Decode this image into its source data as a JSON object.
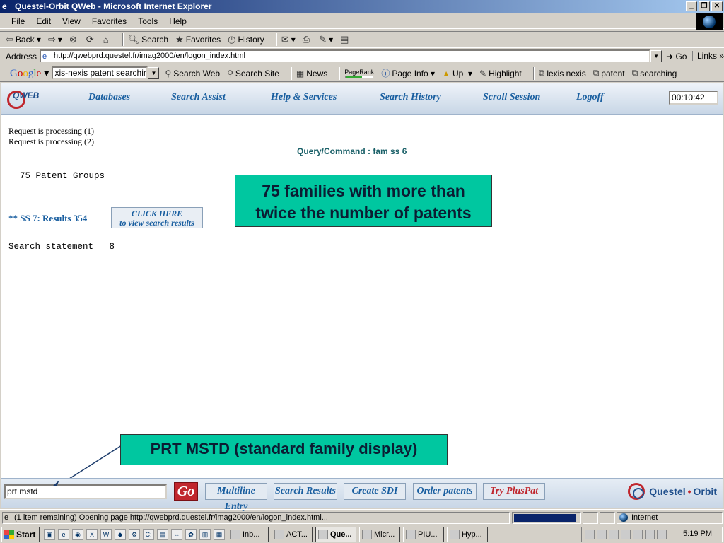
{
  "window": {
    "title": "Questel-Orbit QWeb - Microsoft Internet Explorer"
  },
  "menu": [
    "File",
    "Edit",
    "View",
    "Favorites",
    "Tools",
    "Help"
  ],
  "toolbar": {
    "back": "Back",
    "search": "Search",
    "favorites": "Favorites",
    "history": "History"
  },
  "address": {
    "label": "Address",
    "url": "http://qwebprd.questel.fr/imag2000/en/logon_index.html",
    "go": "Go",
    "links": "Links"
  },
  "google": {
    "query": "xis-nexis patent searching",
    "search_web": "Search Web",
    "search_site": "Search Site",
    "news": "News",
    "pagerank": "PageRank",
    "page_info": "Page Info",
    "up": "Up",
    "highlight": "Highlight",
    "terms": [
      "lexis nexis",
      "patent",
      "searching"
    ]
  },
  "qweb": {
    "nav": [
      "Databases",
      "Search Assist",
      "Help & Services",
      "Search History",
      "Scroll Session",
      "Logoff"
    ],
    "timer": "00:10:42"
  },
  "content": {
    "processing": [
      "Request is processing (1)",
      "Request is processing (2)"
    ],
    "query": "Query/Command : fam ss 6",
    "patent_groups": "75 Patent Groups",
    "ss_result": "** SS 7: Results 354",
    "click_here_1": "CLICK HERE",
    "click_here_2": "to view search results",
    "search_statement": "Search statement   8",
    "callout_1_line1": "75 families with more than",
    "callout_1_line2": "twice the number of patents",
    "callout_2": "PRT MSTD (standard family display)"
  },
  "command": {
    "input_value": "prt mstd",
    "go": "Go",
    "buttons": [
      "Multiline Entry",
      "Search Results",
      "Create SDI",
      "Order patents",
      "Try PlusPat"
    ],
    "brand_a": "Questel",
    "brand_b": "Orbit"
  },
  "status": {
    "text": "(1 item remaining) Opening page http://qwebprd.questel.fr/imag2000/en/logon_index.html...",
    "zone": "Internet",
    "progress": 0.95
  },
  "taskbar": {
    "start": "Start",
    "tasks": [
      "Inb...",
      "ACT...",
      "Que...",
      "Micr...",
      "PIU...",
      "Hyp..."
    ],
    "active_index": 2,
    "clock": "5:19 PM"
  },
  "colors": {
    "callout_bg": "#00c7a0",
    "qweb_nav": "#1a5fa0",
    "brand_red": "#c0262d"
  }
}
